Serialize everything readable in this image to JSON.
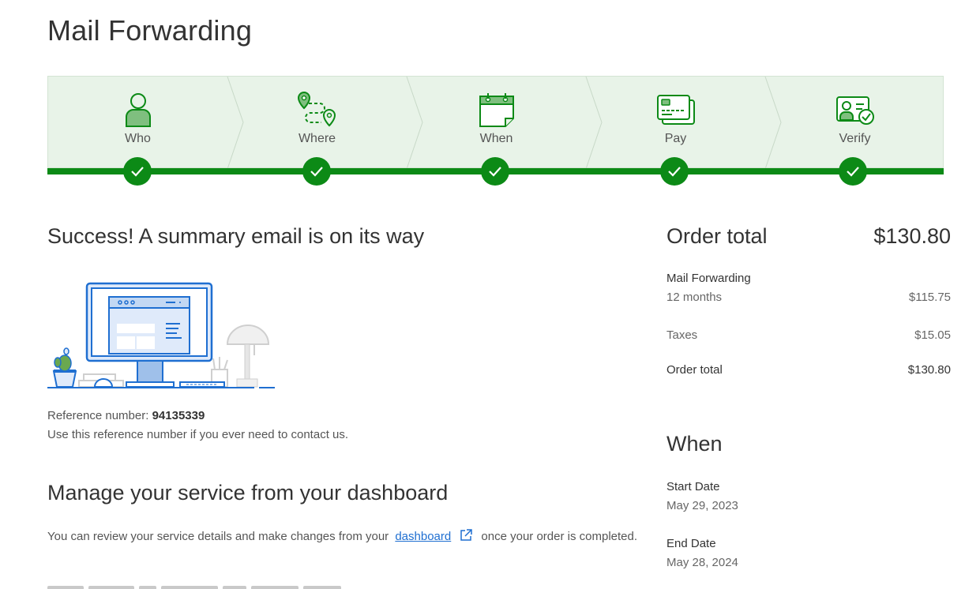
{
  "page": {
    "title": "Mail Forwarding"
  },
  "steps": [
    {
      "label": "Who",
      "icon": "person-icon"
    },
    {
      "label": "Where",
      "icon": "route-pins-icon"
    },
    {
      "label": "When",
      "icon": "calendar-icon"
    },
    {
      "label": "Pay",
      "icon": "credit-cards-icon"
    },
    {
      "label": "Verify",
      "icon": "id-card-check-icon"
    }
  ],
  "colors": {
    "accent_green": "#0c8a16",
    "step_bg": "#e8f3e8",
    "link_blue": "#1f6fd1"
  },
  "success": {
    "title": "Success! A summary email is on its way",
    "reference_label": "Reference number:",
    "reference_number": "94135339",
    "reference_note": "Use this reference number if you ever need to contact us."
  },
  "manage": {
    "title": "Manage your service from your dashboard",
    "text_before": "You can review your service details and make changes from your",
    "link_text": "dashboard",
    "text_after": "once your order is completed."
  },
  "order": {
    "title": "Order total",
    "total": "$130.80",
    "item_name": "Mail Forwarding",
    "item_term": "12 months",
    "item_price": "$115.75",
    "taxes_label": "Taxes",
    "taxes_value": "$15.05",
    "total_label": "Order total",
    "total_value": "$130.80"
  },
  "when": {
    "title": "When",
    "start_label": "Start Date",
    "start_value": "May 29, 2023",
    "end_label": "End Date",
    "end_value": "May 28, 2024"
  }
}
